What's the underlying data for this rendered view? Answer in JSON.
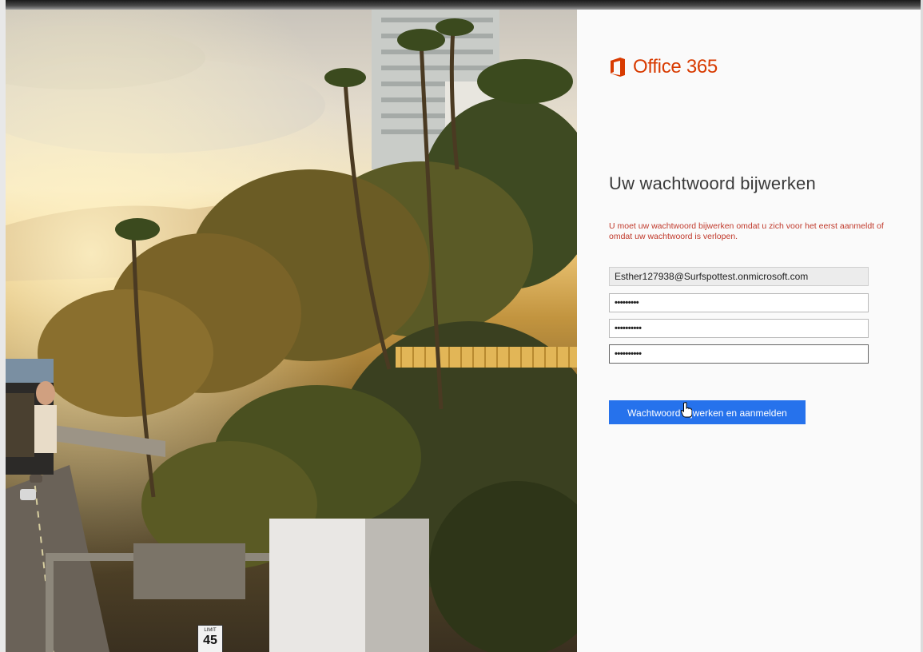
{
  "brand": {
    "name": "Office 365",
    "color": "#d83b01",
    "logo_icon": "office-logo-icon"
  },
  "form": {
    "heading": "Uw wachtwoord bijwerken",
    "notice": "U moet uw wachtwoord bijwerken omdat u zich voor het eerst aanmeldt of omdat uw wachtwoord is verlopen.",
    "username_value": "Esther127938@Surfspottest.onmicrosoft.com",
    "current_password_mask": "•••••••••",
    "new_password_mask": "••••••••••",
    "confirm_password_mask": "••••••••••",
    "submit_label": "Wachtwoord bijwerken en aanmelden",
    "accent_color": "#2672ec",
    "notice_color": "#c0392b"
  },
  "photo": {
    "speed_sign_label": "LIMIT",
    "speed_sign_value": "45"
  }
}
